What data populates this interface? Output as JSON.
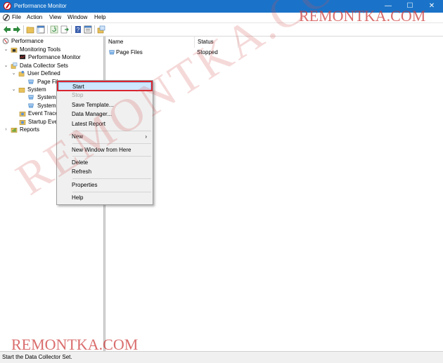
{
  "window": {
    "title": "Performance Monitor",
    "minimize_glyph": "—",
    "maximize_glyph": "☐",
    "close_glyph": "✕"
  },
  "menu": [
    "File",
    "Action",
    "View",
    "Window",
    "Help"
  ],
  "tree": {
    "root": "Performance",
    "monitoring_tools": "Monitoring Tools",
    "performance_monitor": "Performance Monitor",
    "data_collector_sets": "Data Collector Sets",
    "user_defined": "User Defined",
    "page_files": "Page File",
    "system": "System",
    "system_item_1": "System I",
    "system_item_2": "System I",
    "event_trace": "Event Trace",
    "startup_event": "Startup Ever",
    "reports": "Reports"
  },
  "list": {
    "columns": [
      "Name",
      "Status"
    ],
    "rows": [
      {
        "name": "Page Files",
        "status": "Stopped"
      }
    ]
  },
  "context_menu": {
    "start": "Start",
    "stop": "Stop",
    "save_template": "Save Template...",
    "data_manager": "Data Manager...",
    "latest_report": "Latest Report",
    "new": "New",
    "new_window": "New Window from Here",
    "delete": "Delete",
    "refresh": "Refresh",
    "properties": "Properties",
    "help": "Help",
    "submenu_arrow": "›"
  },
  "status_bar": "Start the Data Collector Set.",
  "watermarks": {
    "top": "REMONTKA.COM",
    "bottom": "REMONTKA.COM",
    "diagonal": "REMONTKA.COM"
  },
  "colors": {
    "titlebar": "#1a73c8",
    "highlight_border": "#d9252f",
    "selection": "#cde8ff"
  }
}
